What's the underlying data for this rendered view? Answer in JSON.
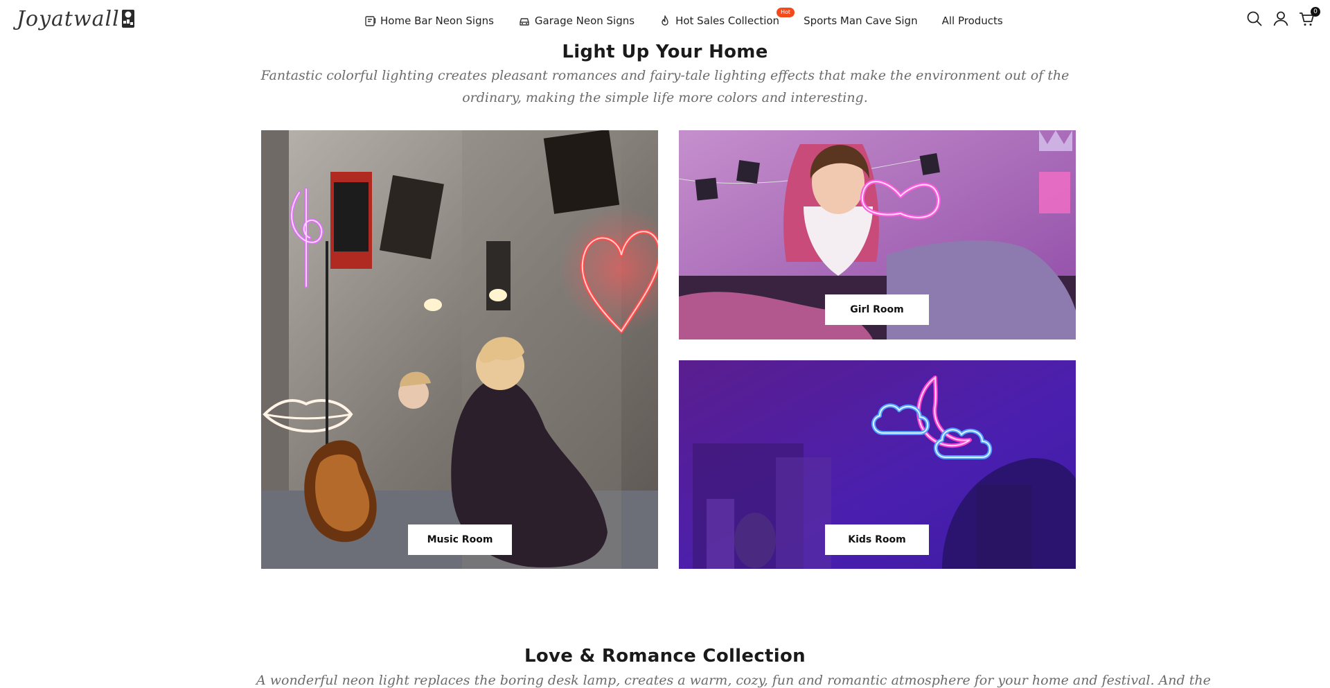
{
  "brand": {
    "name": "Joyatwall",
    "logo_icon": "logo-mark-icon"
  },
  "nav": {
    "items": [
      {
        "label": "Home Bar Neon Signs",
        "icon": "bar-sign-icon"
      },
      {
        "label": "Garage Neon Signs",
        "icon": "car-icon"
      },
      {
        "label": "Hot Sales Collection",
        "icon": "flame-icon",
        "badge": "Hot"
      },
      {
        "label": "Sports Man Cave Sign"
      },
      {
        "label": "All Products"
      }
    ]
  },
  "header_icons": {
    "search": "search-icon",
    "account": "user-icon",
    "cart": "cart-icon",
    "cart_count": "0"
  },
  "section1": {
    "title": "Light Up Your Home",
    "subtitle": "Fantastic colorful lighting creates pleasant romances and fairy-tale lighting effects that make the environment out of the ordinary, making the simple life more colors and interesting.",
    "tiles": [
      {
        "label": "Music Room"
      },
      {
        "label": "Girl Room"
      },
      {
        "label": "Kids Room"
      }
    ]
  },
  "section2": {
    "title": "Love & Romance Collection",
    "subtitle": "A wonderful neon light replaces the boring desk lamp, creates a warm, cozy, fun and romantic atmosphere for your home and festival. And the"
  },
  "colors": {
    "hot_badge": "#f44a1a",
    "text": "#1a1a1a",
    "subtitle": "#6b6b6b"
  }
}
